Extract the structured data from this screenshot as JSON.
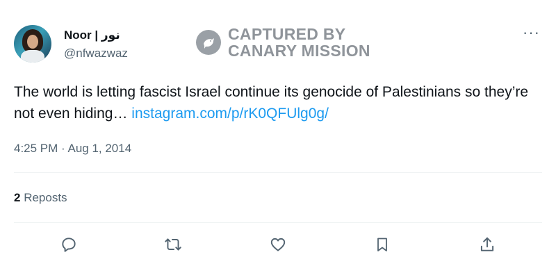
{
  "author": {
    "display_name": "Noor | نور",
    "handle": "@nfwazwaz"
  },
  "watermark": {
    "line1": "CAPTURED BY",
    "line2": "CANARY MISSION",
    "icon": "canary-bird-icon"
  },
  "more_icon": "more-options-icon",
  "tweet": {
    "text": "The world is letting fascist Israel continue its genocide of Palestinians so they’re not even hiding… ",
    "link": "instagram.com/p/rK0QFUlg0g/"
  },
  "timestamp": "4:25 PM · Aug 1, 2014",
  "stats": {
    "reposts_count": "2",
    "reposts_label": " Reposts"
  },
  "actions": [
    "reply-icon",
    "repost-icon",
    "like-icon",
    "bookmark-icon",
    "share-icon"
  ],
  "colors": {
    "text": "#0f1419",
    "secondary": "#536471",
    "link": "#1d9bf0",
    "divider": "#eff3f4",
    "watermark": "#8f949a"
  }
}
